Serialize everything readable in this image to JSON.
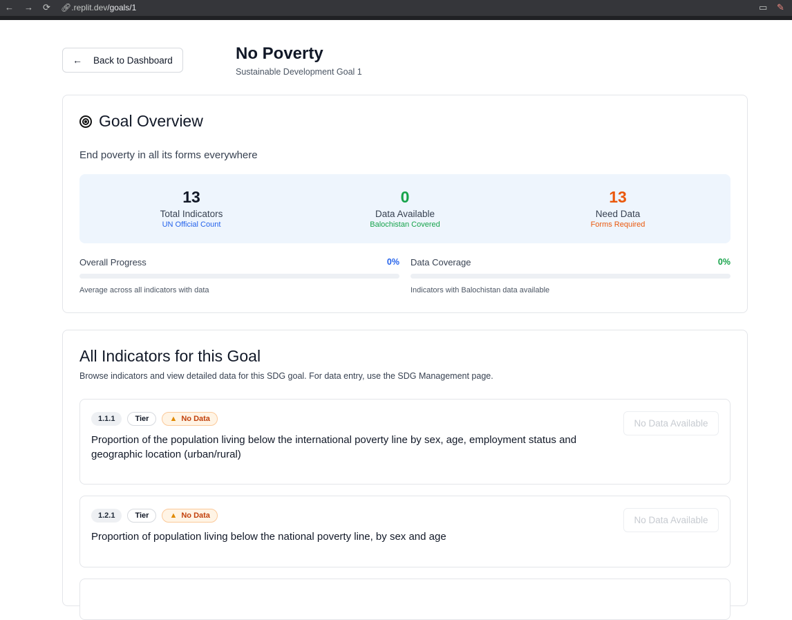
{
  "browser": {
    "url_host": ".replit.dev",
    "url_path": "/goals/1"
  },
  "header": {
    "back_label": "Back to Dashboard",
    "title": "No Poverty",
    "subtitle": "Sustainable Development Goal 1"
  },
  "overview": {
    "title": "Goal Overview",
    "description": "End poverty in all its forms everywhere",
    "stats": [
      {
        "value": "13",
        "label": "Total Indicators",
        "sub": "UN Official Count",
        "color": "#111827",
        "sub_color": "#2563eb"
      },
      {
        "value": "0",
        "label": "Data Available",
        "sub": "Balochistan Covered",
        "color": "#16a34a",
        "sub_color": "#16a34a"
      },
      {
        "value": "13",
        "label": "Need Data",
        "sub": "Forms Required",
        "color": "#ea580c",
        "sub_color": "#ea580c"
      }
    ],
    "progress": {
      "label": "Overall Progress",
      "value": "0%",
      "fraction": 0,
      "note": "Average across all indicators with data",
      "color": "#2563eb"
    },
    "coverage": {
      "label": "Data Coverage",
      "value": "0%",
      "fraction": 0,
      "note": "Indicators with Balochistan data available",
      "color": "#16a34a"
    }
  },
  "indicators": {
    "title": "All Indicators for this Goal",
    "description": "Browse indicators and view detailed data for this SDG goal. For data entry, use the SDG Management page.",
    "items": [
      {
        "code": "1.1.1",
        "tier": "Tier",
        "status": "No Data",
        "text": "Proportion of the population living below the international poverty line by sex, age, employment status and geographic location (urban/rural)",
        "button": "No Data Available"
      },
      {
        "code": "1.2.1",
        "tier": "Tier",
        "status": "No Data",
        "text": "Proportion of population living below the national poverty line, by sex and age",
        "button": "No Data Available"
      }
    ]
  }
}
